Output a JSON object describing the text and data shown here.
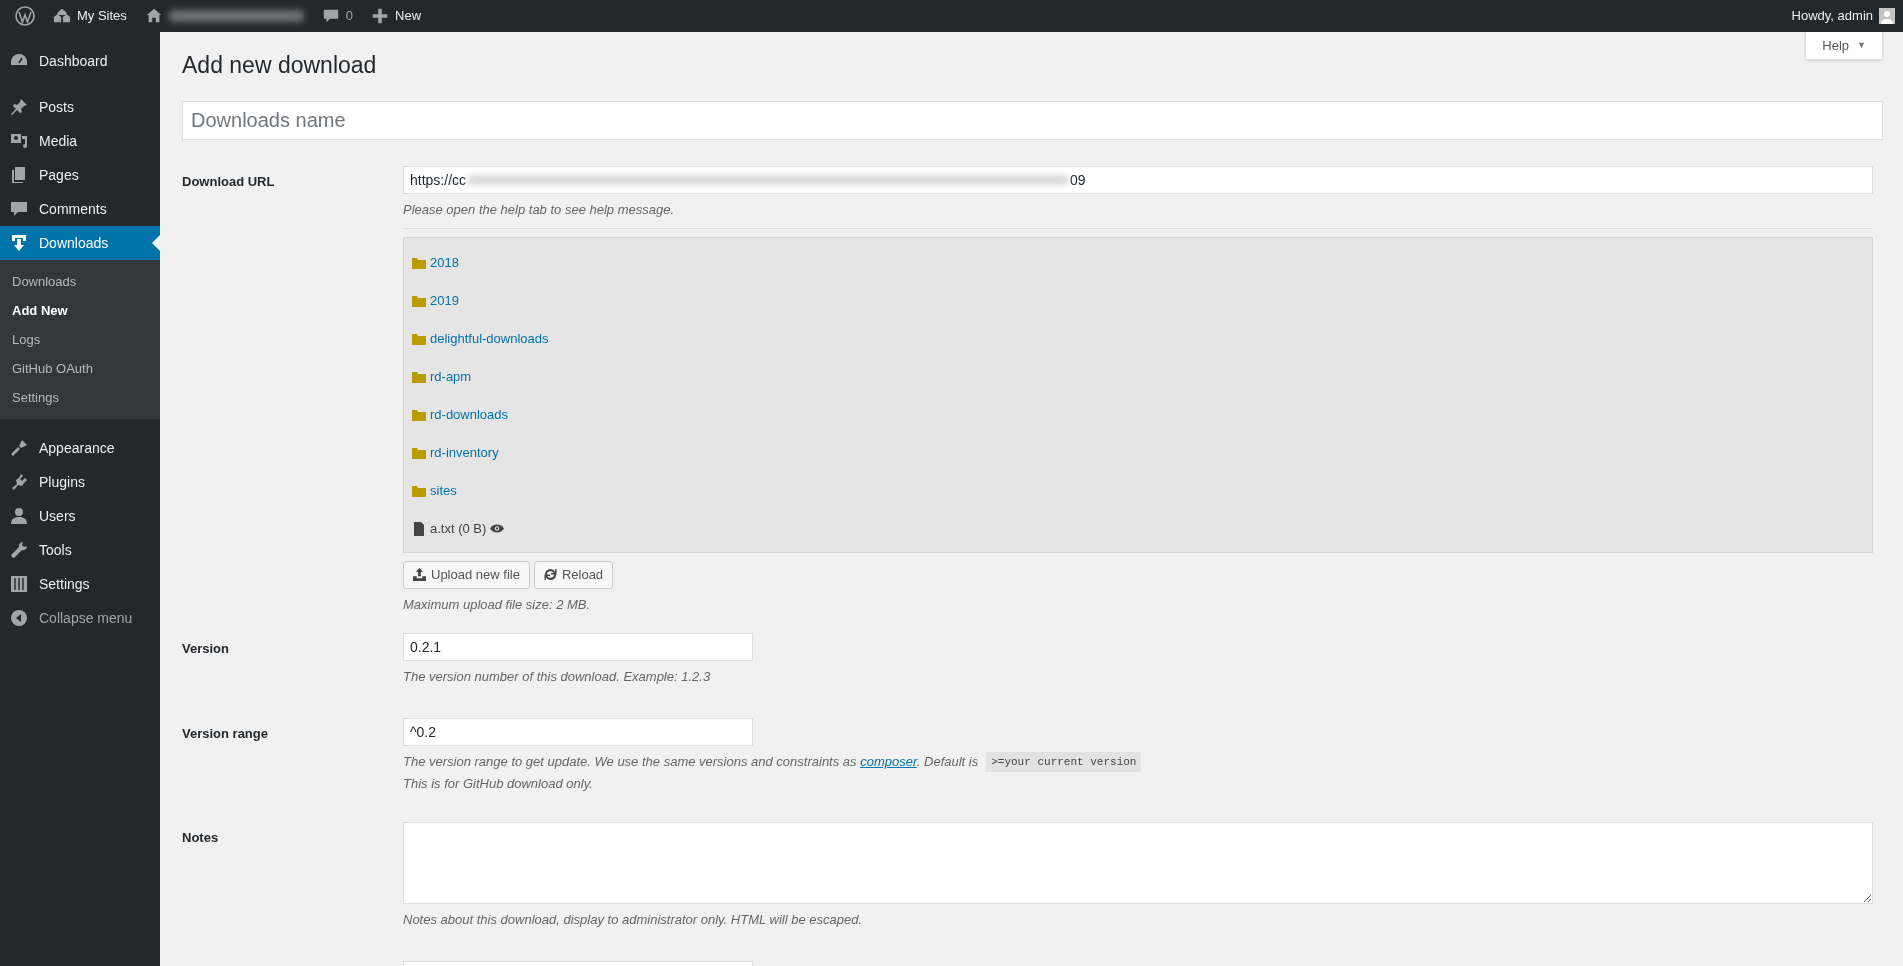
{
  "admin_bar": {
    "items": [
      {
        "kind": "logo"
      },
      {
        "kind": "sites",
        "label": "My Sites"
      },
      {
        "kind": "home"
      },
      {
        "kind": "comments",
        "label": "0"
      },
      {
        "kind": "new",
        "label": "New"
      }
    ],
    "account": "Howdy, admin"
  },
  "sidebar": {
    "groups": [
      [
        {
          "kind": "dashboard",
          "label": "Dashboard",
          "selected": false
        }
      ],
      [
        {
          "kind": "posts",
          "label": "Posts",
          "selected": false
        },
        {
          "kind": "media",
          "label": "Media",
          "selected": false
        },
        {
          "kind": "pages",
          "label": "Pages",
          "selected": false
        },
        {
          "kind": "comments",
          "label": "Comments",
          "selected": false
        },
        {
          "kind": "downloads",
          "label": "Downloads",
          "selected": true,
          "children": [
            {
              "label": "Downloads",
              "selected": false
            },
            {
              "label": "Add New",
              "selected": true
            },
            {
              "label": "Logs",
              "selected": false
            },
            {
              "label": "GitHub OAuth",
              "selected": false
            },
            {
              "label": "Settings",
              "selected": false
            }
          ]
        }
      ],
      [
        {
          "kind": "appearance",
          "label": "Appearance",
          "selected": false
        },
        {
          "kind": "plugins",
          "label": "Plugins",
          "selected": false
        },
        {
          "kind": "users",
          "label": "Users",
          "selected": false
        },
        {
          "kind": "tools",
          "label": "Tools",
          "selected": false
        },
        {
          "kind": "settings",
          "label": "Settings",
          "selected": false
        },
        {
          "kind": "collapse",
          "label": "Collapse menu",
          "selected": false
        }
      ]
    ]
  },
  "help_tab": {
    "label": "Help",
    "caret": "▼"
  },
  "page_title": "Add new download",
  "title_field": {
    "placeholder": "Downloads name"
  },
  "rows": [
    {
      "kind": "url",
      "label": "Download URL",
      "value_start": "https://cc",
      "value_end": "09",
      "help": "Please open the help tab to see help message.",
      "browser": {
        "entries": [
          {
            "kind": "folder",
            "name": "2018"
          },
          {
            "kind": "folder",
            "name": "2019"
          },
          {
            "kind": "folder",
            "name": "delightful-downloads"
          },
          {
            "kind": "folder",
            "name": "rd-apm"
          },
          {
            "kind": "folder",
            "name": "rd-downloads"
          },
          {
            "kind": "folder",
            "name": "rd-inventory"
          },
          {
            "kind": "folder",
            "name": "sites"
          },
          {
            "kind": "file",
            "name": "a.txt (0 B)"
          }
        ],
        "buttons": [
          {
            "kind": "upload",
            "label": "Upload new file"
          },
          {
            "kind": "reload",
            "label": "Reload"
          }
        ],
        "note": "Maximum upload file size: 2 MB."
      }
    },
    {
      "kind": "text",
      "label": "Version",
      "value": "0.2.1",
      "help": "The version number of this download. Example: 1.2.3"
    },
    {
      "kind": "text",
      "label": "Version range",
      "value": "^0.2",
      "help": "The version range to get update. We use the same versions and constraints as ",
      "link": "composer",
      "help_after": ". Default is",
      "code": ">=your current version",
      "help2": "This is for GitHub download only."
    },
    {
      "kind": "textarea",
      "label": "Notes",
      "help": "Notes about this download, display to administrator only. HTML will be escaped."
    },
    {
      "kind": "cutoff"
    }
  ]
}
